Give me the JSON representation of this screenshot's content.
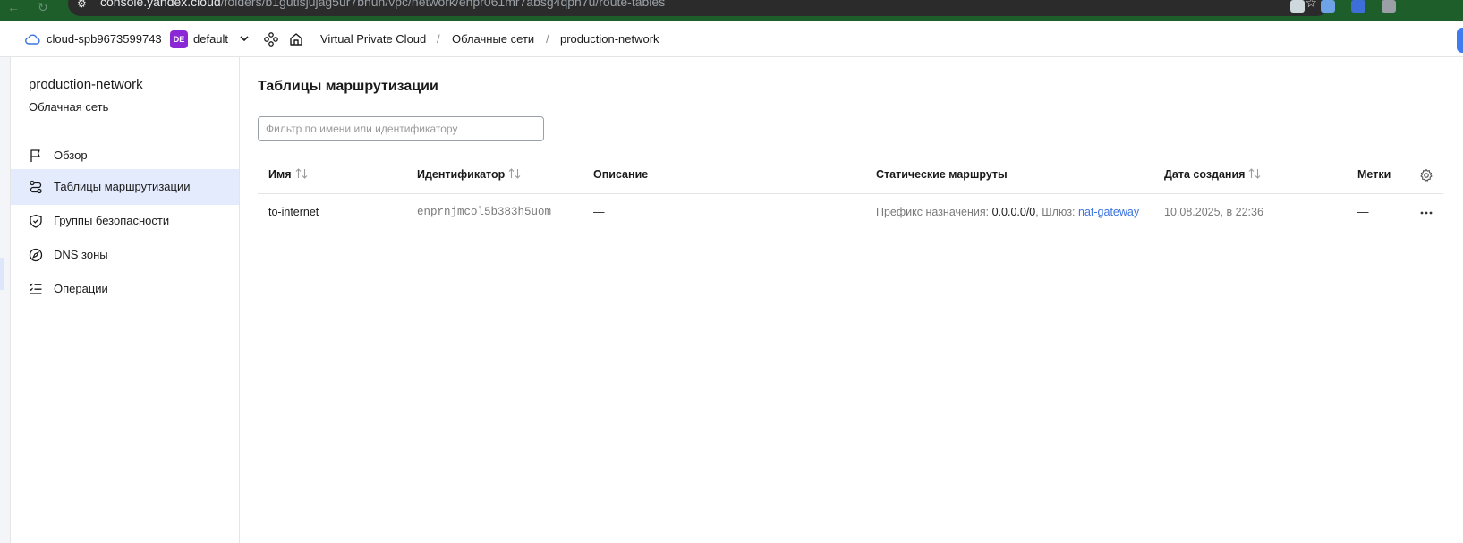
{
  "browser": {
    "url_host": "console.yandex.cloud",
    "url_path": "/folders/b1gutisjujag5ur7bnun/vpc/network/enpr061mr7absg4qph7u/route-tables"
  },
  "header": {
    "cloud_name": "cloud-spb9673599743",
    "folder_badge": "DE",
    "folder_name": "default",
    "breadcrumbs": [
      "Virtual Private Cloud",
      "Облачные сети",
      "production-network"
    ],
    "separator": "/"
  },
  "sidebar": {
    "title": "production-network",
    "subtitle": "Облачная сеть",
    "items": [
      {
        "label": "Обзор",
        "icon": "flag-icon",
        "active": false
      },
      {
        "label": "Таблицы маршрутизации",
        "icon": "route-icon",
        "active": true
      },
      {
        "label": "Группы безопасности",
        "icon": "shield-icon",
        "active": false
      },
      {
        "label": "DNS зоны",
        "icon": "compass-icon",
        "active": false
      },
      {
        "label": "Операции",
        "icon": "list-icon",
        "active": false
      }
    ]
  },
  "main": {
    "title": "Таблицы маршрутизации",
    "filter_placeholder": "Фильтр по имени или идентификатору",
    "columns": {
      "name": "Имя",
      "id": "Идентификатор",
      "description": "Описание",
      "routes": "Статические маршруты",
      "created": "Дата создания",
      "labels": "Метки"
    },
    "rows": [
      {
        "name": "to-internet",
        "id": "enprnjmcol5b383h5uom",
        "description": "—",
        "route_prefix_label": "Префикс назначения:",
        "route_prefix_value": "0.0.0.0/0",
        "route_gateway_label": ", Шлюз:",
        "route_gateway_value": "nat-gateway",
        "created": "10.08.2025, в 22:36",
        "labels": "—"
      }
    ]
  },
  "colors": {
    "accent": "#3c73e0",
    "active_bg": "#e3ebfd",
    "badge": "#8b28d6"
  }
}
